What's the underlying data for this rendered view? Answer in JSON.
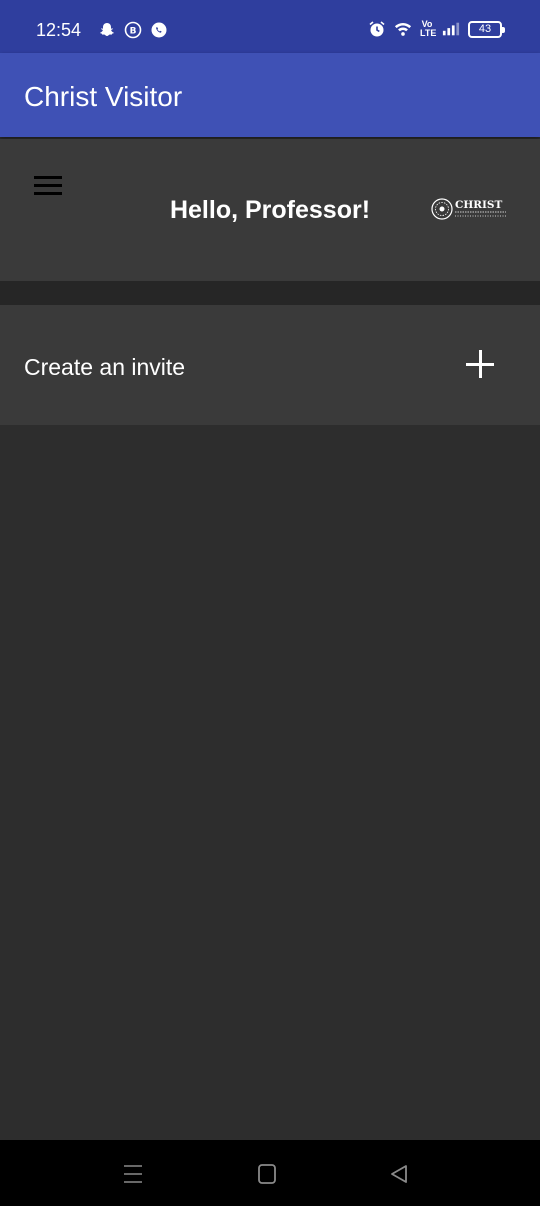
{
  "status_bar": {
    "time": "12:54",
    "left_icons": [
      "snapchat-icon",
      "b-badge-icon",
      "whatsapp-business-icon"
    ],
    "right_icons": [
      "alarm-icon",
      "wifi-icon",
      "volte-icon",
      "signal-icon",
      "battery-icon"
    ],
    "volte_top": "Vo",
    "volte_bottom": "LTE",
    "battery_level": "43",
    "colors": {
      "background": "#2f3e9e"
    }
  },
  "app_bar": {
    "title": "Christ Visitor",
    "color": "#3f51b5"
  },
  "header": {
    "greeting": "Hello, Professor!",
    "menu_icon": "hamburger-menu-icon",
    "logo_text": "CHRIST",
    "logo_icon": "christ-university-logo"
  },
  "invite": {
    "label": "Create an invite",
    "action_icon": "plus-icon"
  },
  "nav_bar": {
    "buttons": [
      "recent-apps-icon",
      "home-icon",
      "back-icon"
    ]
  },
  "theme": {
    "background": "#2d2d2d",
    "card": "#3a3a3a",
    "band": "#262626"
  }
}
